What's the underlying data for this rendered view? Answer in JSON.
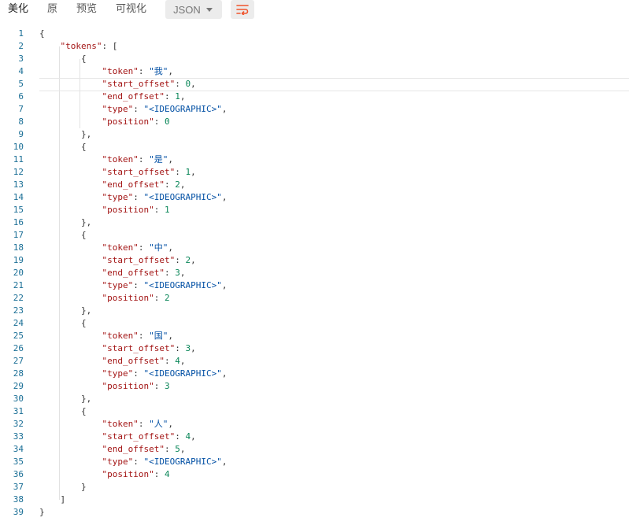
{
  "toolbar": {
    "tabs": [
      {
        "label": "美化",
        "active": true
      },
      {
        "label": "原",
        "active": false
      },
      {
        "label": "预览",
        "active": false
      },
      {
        "label": "可视化",
        "active": false
      }
    ],
    "format_select": "JSON",
    "wrap_icon": "wrap-lines-icon",
    "wrap_color": "#f0542d"
  },
  "editor": {
    "highlighted_line": 5,
    "lines": [
      {
        "n": "1",
        "c": [
          [
            "p",
            "{"
          ]
        ]
      },
      {
        "n": "2",
        "c": [
          [
            "k",
            "\"tokens\""
          ],
          [
            "p",
            ": ["
          ]
        ]
      },
      {
        "n": "3",
        "c": [
          [
            "p",
            "{"
          ]
        ]
      },
      {
        "n": "4",
        "c": [
          [
            "k",
            "\"token\""
          ],
          [
            "p",
            ": "
          ],
          [
            "s",
            "\"我\""
          ],
          [
            "p",
            ","
          ]
        ]
      },
      {
        "n": "5",
        "c": [
          [
            "k",
            "\"start_offset\""
          ],
          [
            "p",
            ": "
          ],
          [
            "n",
            "0"
          ],
          [
            "p",
            ","
          ]
        ]
      },
      {
        "n": "6",
        "c": [
          [
            "k",
            "\"end_offset\""
          ],
          [
            "p",
            ": "
          ],
          [
            "n",
            "1"
          ],
          [
            "p",
            ","
          ]
        ]
      },
      {
        "n": "7",
        "c": [
          [
            "k",
            "\"type\""
          ],
          [
            "p",
            ": "
          ],
          [
            "s",
            "\"<IDEOGRAPHIC>\""
          ],
          [
            "p",
            ","
          ]
        ]
      },
      {
        "n": "8",
        "c": [
          [
            "k",
            "\"position\""
          ],
          [
            "p",
            ": "
          ],
          [
            "n",
            "0"
          ]
        ]
      },
      {
        "n": "9",
        "c": [
          [
            "p",
            "},"
          ]
        ]
      },
      {
        "n": "10",
        "c": [
          [
            "p",
            "{"
          ]
        ]
      },
      {
        "n": "11",
        "c": [
          [
            "k",
            "\"token\""
          ],
          [
            "p",
            ": "
          ],
          [
            "s",
            "\"是\""
          ],
          [
            "p",
            ","
          ]
        ]
      },
      {
        "n": "12",
        "c": [
          [
            "k",
            "\"start_offset\""
          ],
          [
            "p",
            ": "
          ],
          [
            "n",
            "1"
          ],
          [
            "p",
            ","
          ]
        ]
      },
      {
        "n": "13",
        "c": [
          [
            "k",
            "\"end_offset\""
          ],
          [
            "p",
            ": "
          ],
          [
            "n",
            "2"
          ],
          [
            "p",
            ","
          ]
        ]
      },
      {
        "n": "14",
        "c": [
          [
            "k",
            "\"type\""
          ],
          [
            "p",
            ": "
          ],
          [
            "s",
            "\"<IDEOGRAPHIC>\""
          ],
          [
            "p",
            ","
          ]
        ]
      },
      {
        "n": "15",
        "c": [
          [
            "k",
            "\"position\""
          ],
          [
            "p",
            ": "
          ],
          [
            "n",
            "1"
          ]
        ]
      },
      {
        "n": "16",
        "c": [
          [
            "p",
            "},"
          ]
        ]
      },
      {
        "n": "17",
        "c": [
          [
            "p",
            "{"
          ]
        ]
      },
      {
        "n": "18",
        "c": [
          [
            "k",
            "\"token\""
          ],
          [
            "p",
            ": "
          ],
          [
            "s",
            "\"中\""
          ],
          [
            "p",
            ","
          ]
        ]
      },
      {
        "n": "19",
        "c": [
          [
            "k",
            "\"start_offset\""
          ],
          [
            "p",
            ": "
          ],
          [
            "n",
            "2"
          ],
          [
            "p",
            ","
          ]
        ]
      },
      {
        "n": "20",
        "c": [
          [
            "k",
            "\"end_offset\""
          ],
          [
            "p",
            ": "
          ],
          [
            "n",
            "3"
          ],
          [
            "p",
            ","
          ]
        ]
      },
      {
        "n": "21",
        "c": [
          [
            "k",
            "\"type\""
          ],
          [
            "p",
            ": "
          ],
          [
            "s",
            "\"<IDEOGRAPHIC>\""
          ],
          [
            "p",
            ","
          ]
        ]
      },
      {
        "n": "22",
        "c": [
          [
            "k",
            "\"position\""
          ],
          [
            "p",
            ": "
          ],
          [
            "n",
            "2"
          ]
        ]
      },
      {
        "n": "23",
        "c": [
          [
            "p",
            "},"
          ]
        ]
      },
      {
        "n": "24",
        "c": [
          [
            "p",
            "{"
          ]
        ]
      },
      {
        "n": "25",
        "c": [
          [
            "k",
            "\"token\""
          ],
          [
            "p",
            ": "
          ],
          [
            "s",
            "\"国\""
          ],
          [
            "p",
            ","
          ]
        ]
      },
      {
        "n": "26",
        "c": [
          [
            "k",
            "\"start_offset\""
          ],
          [
            "p",
            ": "
          ],
          [
            "n",
            "3"
          ],
          [
            "p",
            ","
          ]
        ]
      },
      {
        "n": "27",
        "c": [
          [
            "k",
            "\"end_offset\""
          ],
          [
            "p",
            ": "
          ],
          [
            "n",
            "4"
          ],
          [
            "p",
            ","
          ]
        ]
      },
      {
        "n": "28",
        "c": [
          [
            "k",
            "\"type\""
          ],
          [
            "p",
            ": "
          ],
          [
            "s",
            "\"<IDEOGRAPHIC>\""
          ],
          [
            "p",
            ","
          ]
        ]
      },
      {
        "n": "29",
        "c": [
          [
            "k",
            "\"position\""
          ],
          [
            "p",
            ": "
          ],
          [
            "n",
            "3"
          ]
        ]
      },
      {
        "n": "30",
        "c": [
          [
            "p",
            "},"
          ]
        ]
      },
      {
        "n": "31",
        "c": [
          [
            "p",
            "{"
          ]
        ]
      },
      {
        "n": "32",
        "c": [
          [
            "k",
            "\"token\""
          ],
          [
            "p",
            ": "
          ],
          [
            "s",
            "\"人\""
          ],
          [
            "p",
            ","
          ]
        ]
      },
      {
        "n": "33",
        "c": [
          [
            "k",
            "\"start_offset\""
          ],
          [
            "p",
            ": "
          ],
          [
            "n",
            "4"
          ],
          [
            "p",
            ","
          ]
        ]
      },
      {
        "n": "34",
        "c": [
          [
            "k",
            "\"end_offset\""
          ],
          [
            "p",
            ": "
          ],
          [
            "n",
            "5"
          ],
          [
            "p",
            ","
          ]
        ]
      },
      {
        "n": "35",
        "c": [
          [
            "k",
            "\"type\""
          ],
          [
            "p",
            ": "
          ],
          [
            "s",
            "\"<IDEOGRAPHIC>\""
          ],
          [
            "p",
            ","
          ]
        ]
      },
      {
        "n": "36",
        "c": [
          [
            "k",
            "\"position\""
          ],
          [
            "p",
            ": "
          ],
          [
            "n",
            "4"
          ]
        ]
      },
      {
        "n": "37",
        "c": [
          [
            "p",
            "}"
          ]
        ]
      },
      {
        "n": "38",
        "c": [
          [
            "p",
            "]"
          ]
        ]
      },
      {
        "n": "39",
        "c": [
          [
            "p",
            "}"
          ]
        ]
      }
    ]
  }
}
